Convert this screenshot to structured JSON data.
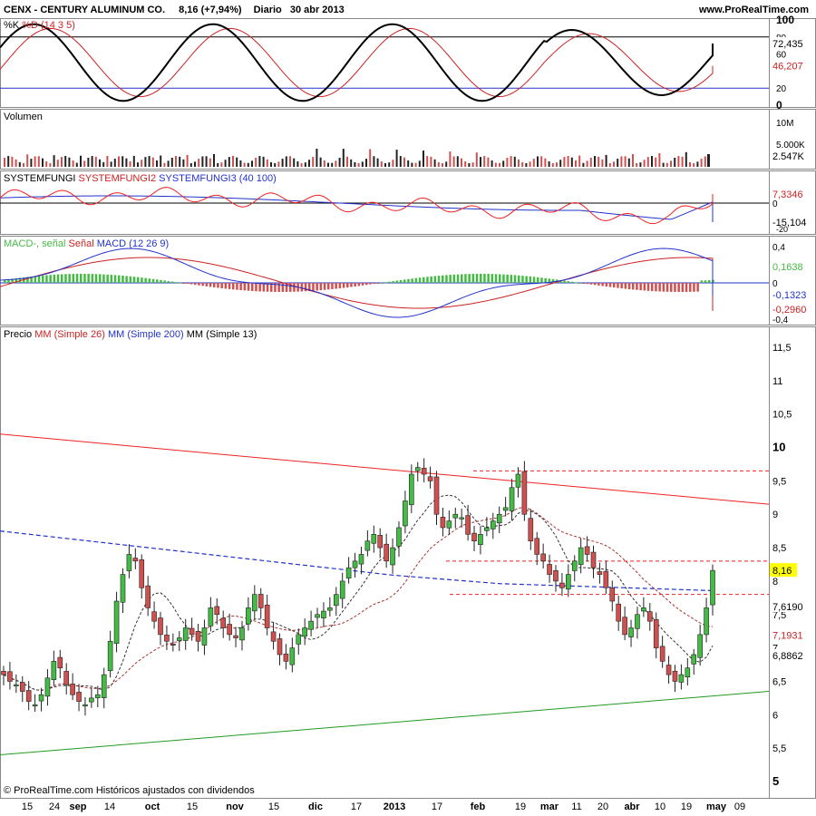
{
  "header": {
    "symbol": "CENX - CENTURY ALUMINUM CO.",
    "price_change": "8,16 (+7,94%)",
    "period": "Diario",
    "date": "30 abr 2013",
    "site": "www.ProRealTime.com"
  },
  "footer": {
    "copyright": "© ProRealTime.com  Históricos ajustados con dividendos"
  },
  "panels": {
    "stoch": {
      "label_k": "%K",
      "label_d": "%D (14 3 5)",
      "ticks": [
        "100",
        "80",
        "60",
        "20",
        "0"
      ],
      "k_value": "72,435",
      "d_value": "46,207"
    },
    "volume": {
      "label": "Volumen",
      "ticks": [
        "10M",
        "5.000K"
      ],
      "value": "2.547K"
    },
    "systemfungi": {
      "label1": "SYSTEMFUNGI",
      "label2": "SYSTEMFUNGI2",
      "label3": "SYSTEMFUNGI3 (40 100)",
      "ticks": [
        "0",
        "-20"
      ],
      "value_red": "7,3346",
      "value_blue": "-15,104"
    },
    "macd": {
      "label1": "MACD-, señal",
      "label2": "Señal",
      "label3": "MACD (12 26 9)",
      "ticks": [
        "0,4",
        "0",
        "-0,4"
      ],
      "value_hist": "0,1638",
      "value_macd": "-0,1323",
      "value_signal": "-0,2960"
    },
    "price": {
      "label_precio": "Precio",
      "label_mm1": "MM",
      "label_s26": "(Simple 26)",
      "label_mm2": "MM",
      "label_s200": "(Simple 200)",
      "label_mm3": "MM",
      "label_s13": "(Simple 13)",
      "ticks": [
        "11,5",
        "11",
        "10,5",
        "10",
        "9,5",
        "9",
        "8,5",
        "8",
        "7,5",
        "7",
        "6,5",
        "6",
        "5,5",
        "5"
      ],
      "last_price": "8,16",
      "ma_labels": [
        "7,6190",
        "7,1931",
        "6,8862"
      ]
    }
  },
  "xaxis": [
    "15",
    "24",
    "sep",
    "14",
    "oct",
    "15",
    "nov",
    "15",
    "dic",
    "17",
    "2013",
    "17",
    "feb",
    "19",
    "mar",
    "11",
    "20",
    "abr",
    "10",
    "19",
    "may",
    "09"
  ],
  "colors": {
    "up": "#44bb44",
    "down": "#d05050",
    "red_line": "#ee2222",
    "blue_line": "#2233cc",
    "green_line": "#229922",
    "last_price_bg": "#ffff00"
  },
  "chart_data": {
    "type": "candlestick",
    "title": "CENX - CENTURY ALUMINUM CO.",
    "ylim": [
      5,
      11.5
    ],
    "last": {
      "price": 8.16,
      "change_pct": 7.94
    },
    "moving_averages": {
      "sma26": 7.619,
      "sma200": 7.619,
      "sma13": 7.1931,
      "other": 6.8862
    },
    "series": [
      {
        "name": "Precio",
        "values": [
          6.6,
          6.5,
          6.45,
          6.35,
          6.2,
          6.15,
          6.3,
          6.55,
          6.8,
          6.7,
          6.45,
          6.3,
          6.2,
          6.15,
          6.25,
          6.3,
          6.6,
          7.1,
          7.7,
          8.1,
          8.4,
          8.3,
          7.9,
          7.6,
          7.4,
          7.2,
          7.1,
          7.05,
          7.15,
          7.3,
          7.2,
          7.1,
          7.3,
          7.6,
          7.5,
          7.3,
          7.2,
          7.15,
          7.3,
          7.6,
          7.8,
          7.6,
          7.3,
          7.1,
          6.9,
          6.8,
          7.0,
          7.2,
          7.3,
          7.4,
          7.5,
          7.55,
          7.6,
          7.8,
          8.0,
          8.2,
          8.3,
          8.4,
          8.6,
          8.7,
          8.5,
          8.3,
          8.5,
          8.8,
          9.2,
          9.6,
          9.7,
          9.6,
          9.5,
          9.0,
          8.8,
          8.9,
          9.0,
          8.95,
          8.7,
          8.6,
          8.7,
          8.8,
          8.9,
          9.0,
          9.1,
          9.4,
          9.6,
          9.0,
          8.6,
          8.4,
          8.3,
          8.1,
          8.0,
          7.9,
          8.1,
          8.3,
          8.5,
          8.4,
          8.2,
          8.1,
          7.9,
          7.7,
          7.4,
          7.2,
          7.3,
          7.5,
          7.6,
          7.4,
          7.0,
          6.8,
          6.6,
          6.5,
          6.6,
          6.7,
          6.9,
          7.2,
          7.6,
          8.16
        ]
      }
    ],
    "resistance_levels": [
      9.65,
      8.3,
      7.8
    ],
    "trendlines": [
      {
        "name": "resistance",
        "from": 10.2,
        "to": 9.15
      },
      {
        "name": "support",
        "from": 5.4,
        "to": 6.35
      }
    ]
  }
}
